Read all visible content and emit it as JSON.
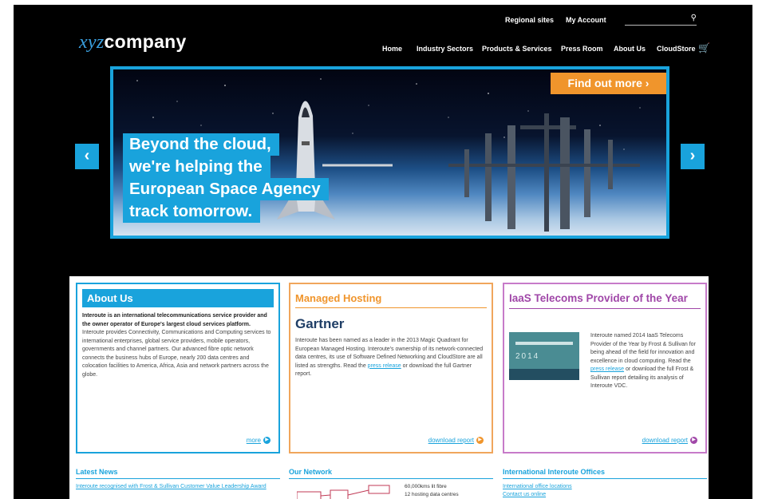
{
  "brand": {
    "logo_prefix": "xyz",
    "logo_suffix": "company",
    "accent": "#19a3dc",
    "orange": "#f0952c",
    "purple": "#a047a8"
  },
  "header": {
    "util_links": [
      "Regional sites",
      "My Account"
    ],
    "search": {
      "value": "",
      "placeholder": ""
    },
    "nav": [
      "Home",
      "Industry Sectors",
      "Products & Services",
      "Press Room",
      "About Us",
      "CloudStore"
    ]
  },
  "hero": {
    "cta": "Find out more ›",
    "headline": [
      "Beyond the cloud,",
      "we're helping the",
      "European Space Agency",
      "track tomorrow."
    ],
    "prev": "‹",
    "next": "›"
  },
  "panels": {
    "about": {
      "title": "About Us",
      "lead": "Interoute is an international telecommunications service provider and the owner operator of Europe's largest cloud services platform.",
      "body": "Interoute provides Connectivity, Communications and Computing services to international enterprises, global service providers, mobile operators, governments and channel partners. Our advanced fibre optic network connects the business hubs of Europe, nearly 200 data centres and colocation facilities to America, Africa, Asia and network partners across the globe.",
      "link": "more"
    },
    "hosting": {
      "title": "Managed Hosting",
      "logo": "Gartner",
      "body_pre": "Interoute has been named as a leader in the 2013 Magic Quadrant for European Managed Hosting. Interoute's ownership of its network-connected data centres, its use of Software Defined Networking and CloudStore are all listed as strengths. Read the ",
      "body_link": "press release",
      "body_post": " or download the full Gartner report.",
      "link": "download report"
    },
    "iaas": {
      "title": "IaaS Telecoms Provider of the Year",
      "report_year": "2014",
      "body_pre": "Interoute named 2014 IaaS Telecoms Provider of the Year by Frost & Sullivan for being ahead of the field for innovation and excellence in cloud computing. Read the ",
      "body_link": "press release",
      "body_post": " or download the full Frost & Sullivan report detailing its analysis of Interoute VDC.",
      "link": "download report"
    }
  },
  "bottom": {
    "news": {
      "title": "Latest News",
      "link": "Interoute recognised with Frost & Sullivan Customer Value Leadership Award"
    },
    "network": {
      "title": "Our Network",
      "stats": [
        "60,000kms lit fibre",
        "12 hosting data centres"
      ]
    },
    "offices": {
      "title": "International Interoute Offices",
      "links": [
        "International office locations",
        "Contact us online"
      ]
    }
  }
}
